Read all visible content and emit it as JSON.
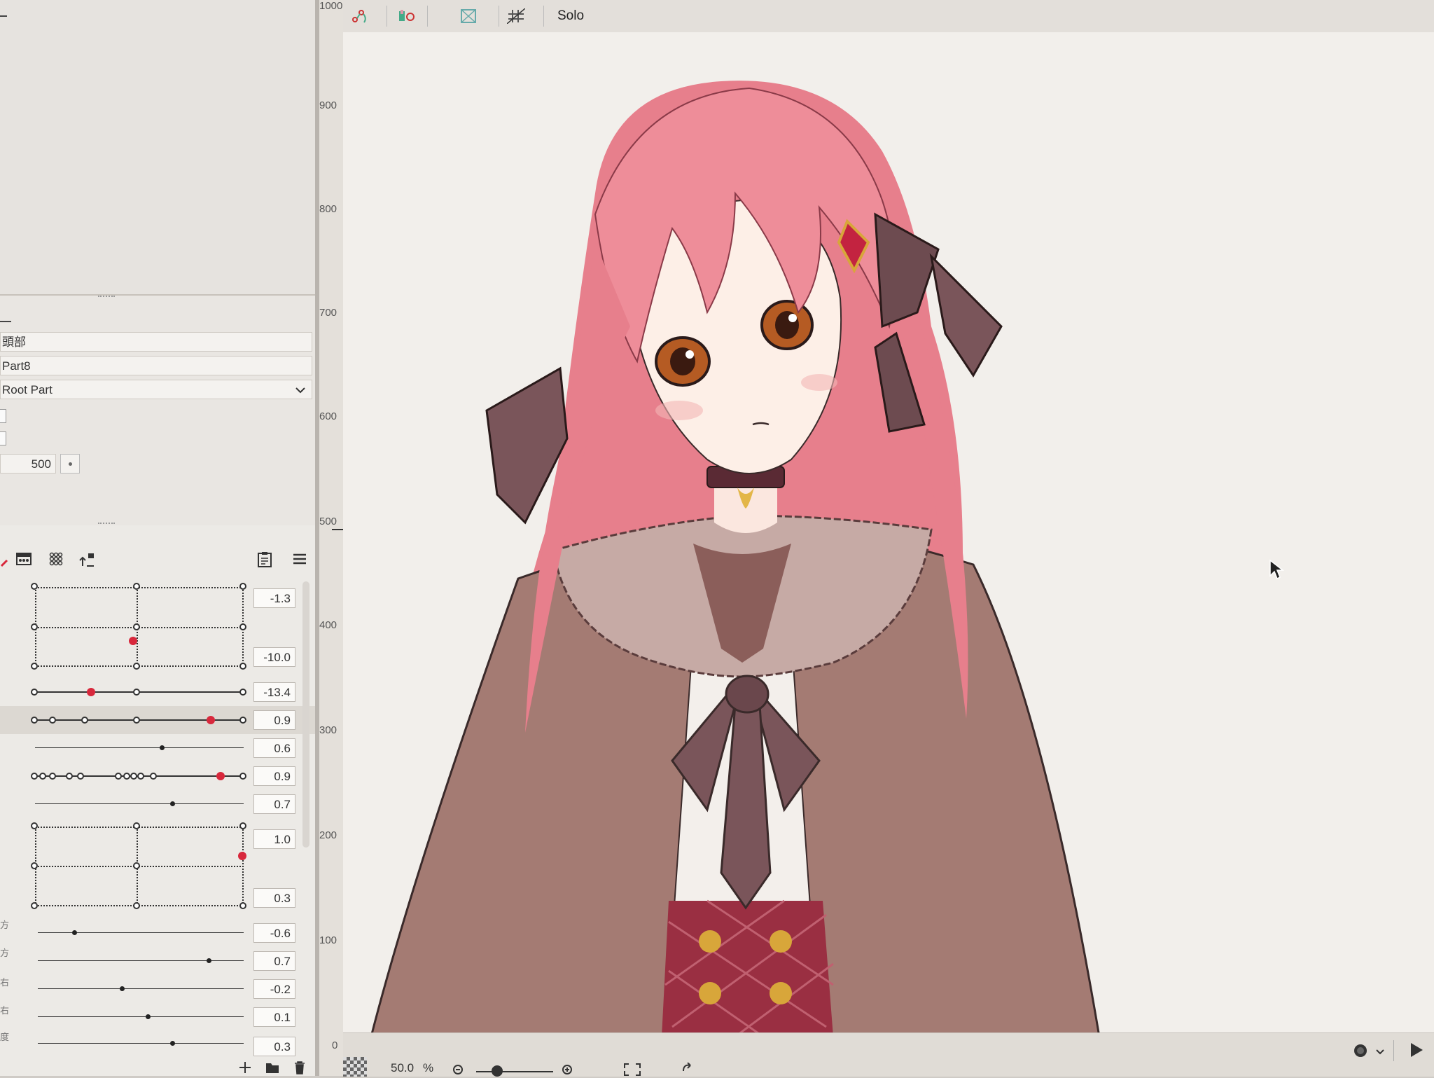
{
  "toolbar": {
    "solo_label": "Solo"
  },
  "ruler": {
    "labels": [
      "1000",
      "900",
      "800",
      "700",
      "600",
      "500",
      "400",
      "300",
      "200",
      "100",
      "0"
    ]
  },
  "properties": {
    "name_field": "頭部",
    "id_field": "Part8",
    "parent_select": "Root Part",
    "number_field": "500"
  },
  "parameters": {
    "values": [
      "-1.3",
      "-10.0",
      "-13.4",
      "0.9",
      "0.6",
      "0.9",
      "0.7",
      "1.0",
      "0.3",
      "-0.6",
      "0.7",
      "-0.2",
      "0.1",
      "0.3"
    ],
    "side_labels": [
      "方",
      "方",
      "右",
      "右",
      "度"
    ]
  },
  "bottombar": {
    "zoom_value": "50.0",
    "zoom_unit": "%"
  },
  "colors": {
    "accent": "#d8283c",
    "panel": "#e9e6e2",
    "canvas": "#f2efeb"
  },
  "icons": [
    "camera-icon",
    "camera-refresh-icon",
    "camera-export-icon",
    "play-icon",
    "menu-icon",
    "plus-icon",
    "trash-icon",
    "folder-icon",
    "checker-icon"
  ]
}
